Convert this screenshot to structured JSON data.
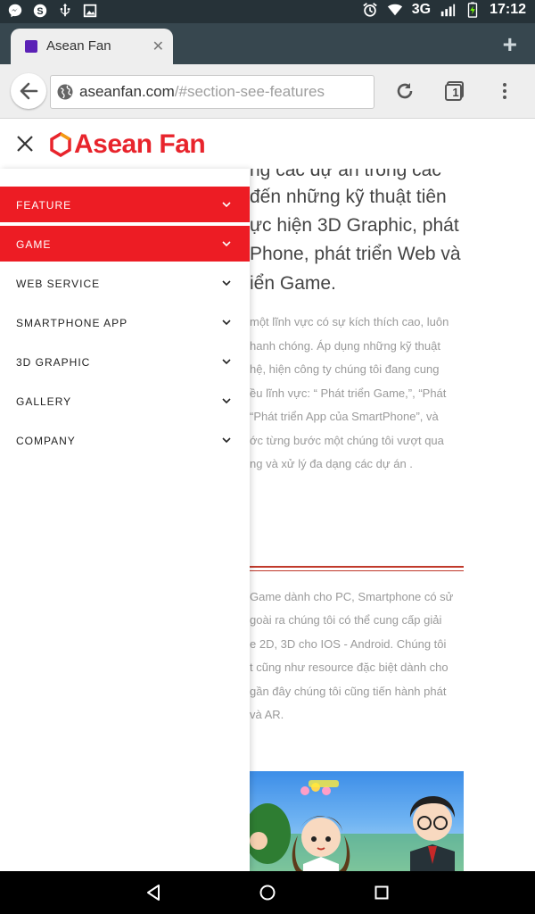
{
  "status_bar": {
    "time": "17:12",
    "network": "3G",
    "left_icons": [
      "messenger-icon",
      "skype-icon",
      "usb-icon",
      "image-icon"
    ],
    "right_icons": [
      "alarm-icon",
      "wifi-icon",
      "signal-icon",
      "battery-icon"
    ]
  },
  "browser": {
    "tab_title": "Asean Fan",
    "url_domain": "aseanfan.com",
    "url_path": "/#section-see-features",
    "tab_count": "1"
  },
  "site": {
    "logo_text": "Asean Fan"
  },
  "menu": {
    "items": [
      {
        "label": "FEATURE",
        "active": true
      },
      {
        "label": "GAME",
        "active": true
      },
      {
        "label": "WEB SERVICE",
        "active": false
      },
      {
        "label": "SMARTPHONE APP",
        "active": false
      },
      {
        "label": "3D GRAPHIC",
        "active": false
      },
      {
        "label": "GALLERY",
        "active": false
      },
      {
        "label": "COMPANY",
        "active": false
      }
    ]
  },
  "content": {
    "big_lines": [
      "ng các dự án trong các",
      "đến những kỹ thuật tiên",
      "ực hiện 3D Graphic, phát",
      "Phone, phát triển Web và",
      "iển Game."
    ],
    "para1": [
      "một lĩnh vực có sự kích thích cao, luôn",
      "hanh chóng. Áp dụng những kỹ thuật",
      "hệ, hiện công ty chúng tôi đang cung",
      "ều lĩnh vực: “ Phát triển Game,”, “Phát",
      " “Phát triển App của SmartPhone”, và",
      "ớc từng bước một chúng tôi vượt qua",
      "ng và xử lý đa dạng các dự án ."
    ],
    "para2": [
      "Game dành cho PC, Smartphone có sử",
      "goài ra chúng tôi có thể cung cấp giải",
      "e 2D, 3D cho IOS - Android. Chúng tôi",
      "t cũng như resource đặc biệt dành cho",
      "gần đây chúng tôi cũng tiến hành phát",
      " và AR."
    ]
  },
  "colors": {
    "accent": "#ed1c24",
    "status_bar": "#263238",
    "tab_strip": "#37474f"
  }
}
